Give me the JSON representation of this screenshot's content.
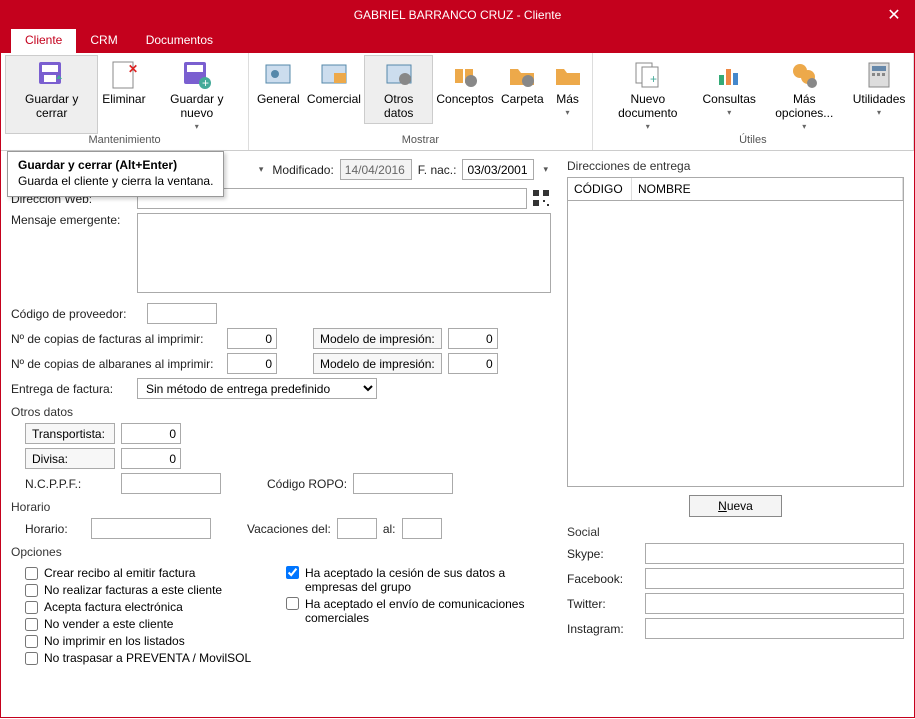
{
  "title": "GABRIEL BARRANCO CRUZ - Cliente",
  "tabs": {
    "cliente": "Cliente",
    "crm": "CRM",
    "documentos": "Documentos"
  },
  "ribbon": {
    "groups": {
      "mantenimiento": "Mantenimiento",
      "mostrar": "Mostrar",
      "utiles": "Útiles"
    },
    "btn": {
      "guardarcerrar": "Guardar y cerrar",
      "eliminar": "Eliminar",
      "guardarnuevo": "Guardar y nuevo",
      "general": "General",
      "comercial": "Comercial",
      "otrosdatos": "Otros datos",
      "conceptos": "Conceptos",
      "carpeta": "Carpeta",
      "mas": "Más",
      "nuevodoc": "Nuevo documento",
      "consultas": "Consultas",
      "masopc": "Más opciones...",
      "utilidades": "Utilidades"
    }
  },
  "tooltip": {
    "title": "Guardar y cerrar (Alt+Enter)",
    "body": "Guarda el cliente y cierra la ventana."
  },
  "topfields": {
    "modificado_lbl": "Modificado:",
    "modificado_val": "14/04/2016",
    "fnac_lbl": "F. nac.:",
    "fnac_val": "03/03/2001"
  },
  "form": {
    "direccionweb_lbl": "Dirección Web:",
    "mensaje_lbl": "Mensaje emergente:",
    "codigoprov_lbl": "Código de proveedor:",
    "ncopiasfact_lbl": "Nº de copias de facturas al imprimir:",
    "ncopiasalb_lbl": "Nº de copias de albaranes al imprimir:",
    "modeloimp_lbl": "Modelo de impresión:",
    "ncopias_val": "0",
    "modelo_val": "0",
    "entregafact_lbl": "Entrega de factura:",
    "entregafact_val": "Sin método de entrega predefinido"
  },
  "otrosdatos": {
    "title": "Otros datos",
    "transportista_lbl": "Transportista:",
    "transportista_val": "0",
    "divisa_lbl": "Divisa:",
    "divisa_val": "0",
    "ncppf_lbl": "N.C.P.P.F.:",
    "codigoropo_lbl": "Código ROPO:"
  },
  "horario": {
    "title": "Horario",
    "horario_lbl": "Horario:",
    "vacaciones_lbl": "Vacaciones del:",
    "al_lbl": "al:"
  },
  "opciones": {
    "title": "Opciones",
    "crearrecibo": "Crear recibo al emitir factura",
    "norealizar": "No realizar facturas a este cliente",
    "aceptaelec": "Acepta factura electrónica",
    "novender": "No vender a este cliente",
    "noimprimir": "No imprimir en los listados",
    "notraspasar": "No traspasar a PREVENTA / MovilSOL",
    "aceptacesion": "Ha aceptado la cesión de sus datos a empresas del grupo",
    "aceptacomms": "Ha aceptado el envío de comunicaciones comerciales"
  },
  "direcciones": {
    "title": "Direcciones de entrega",
    "col_codigo": "CÓDIGO",
    "col_nombre": "NOMBRE",
    "nueva": "Nueva"
  },
  "social": {
    "title": "Social",
    "skype": "Skype:",
    "facebook": "Facebook:",
    "twitter": "Twitter:",
    "instagram": "Instagram:"
  }
}
